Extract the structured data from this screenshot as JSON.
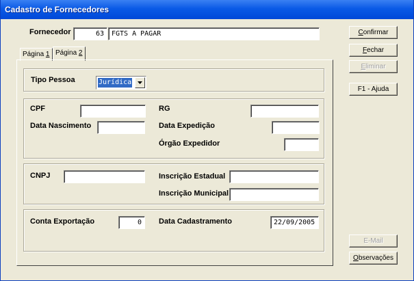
{
  "window": {
    "title": "Cadastro de Fornecedores"
  },
  "header": {
    "fornecedor_label": "Fornecedor",
    "fornecedor_code": "63",
    "fornecedor_name": "FGTS A PAGAR"
  },
  "tabs": [
    {
      "label": "Página 1",
      "underline_char": "1"
    },
    {
      "label": "Página 2",
      "underline_char": "2"
    }
  ],
  "tipo_pessoa": {
    "label": "Tipo Pessoa",
    "value": "Jurídica"
  },
  "fisica": {
    "cpf_label": "CPF",
    "cpf_value": "",
    "rg_label": "RG",
    "rg_value": "",
    "data_nascimento_label": "Data Nascimento",
    "data_nascimento_value": "",
    "data_expedicao_label": "Data Expedição",
    "data_expedicao_value": "",
    "orgao_expedidor_label": "Órgão Expedidor",
    "orgao_expedidor_value": ""
  },
  "juridica": {
    "cnpj_label": "CNPJ",
    "cnpj_value": "",
    "inscricao_estadual_label": "Inscrição Estadual",
    "inscricao_estadual_value": "",
    "inscricao_municipal_label": "Inscrição Municipal",
    "inscricao_municipal_value": ""
  },
  "extra": {
    "conta_exportacao_label": "Conta Exportação",
    "conta_exportacao_value": "0",
    "data_cadastramento_label": "Data Cadastramento",
    "data_cadastramento_value": "22/09/2005"
  },
  "buttons": {
    "confirmar": {
      "pre": "",
      "key": "C",
      "post": "onfirmar"
    },
    "fechar": {
      "pre": "",
      "key": "F",
      "post": "echar"
    },
    "eliminar": {
      "pre": "",
      "key": "E",
      "post": "liminar"
    },
    "ajuda": "F1 - Ajuda",
    "email": "E-Mail",
    "observacoes": {
      "pre": "",
      "key": "O",
      "post": "bservações"
    }
  },
  "colors": {
    "title_bar": "#0a5ae6",
    "face": "#ece9d8",
    "selection": "#316ac5"
  }
}
